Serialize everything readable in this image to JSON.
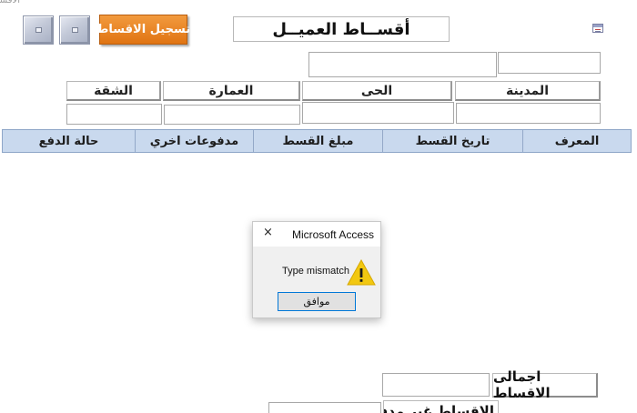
{
  "window": {
    "tab_title": "الاقساط"
  },
  "toolbar": {
    "install_button_label": "تسجيل الاقساط",
    "nav_buttons": [
      "record-navigation-button",
      "record-navigation-button"
    ]
  },
  "header": {
    "title": "أقســاط العميــل"
  },
  "address": {
    "city_label": "المدينة",
    "district_label": "الحى",
    "building_label": "العمارة",
    "apartment_label": "الشقة"
  },
  "table": {
    "columns": [
      "المعرف",
      "تاريخ القسط",
      "مبلغ القسط",
      "مدفوعات اخري",
      "حالة الدفع"
    ]
  },
  "dialog": {
    "title": "Microsoft Access",
    "close_glyph": "×",
    "message": "Type mismatch",
    "ok_label": "موافق",
    "icon": "warning-icon"
  },
  "footer": {
    "total_label": "اجمالى الاقساط",
    "unpaid_label": "الاقساط غير مدفوعة"
  },
  "colors": {
    "accent_orange": "#e98226",
    "header_blue": "#c9d9ee",
    "warning_yellow": "#f2c811"
  }
}
